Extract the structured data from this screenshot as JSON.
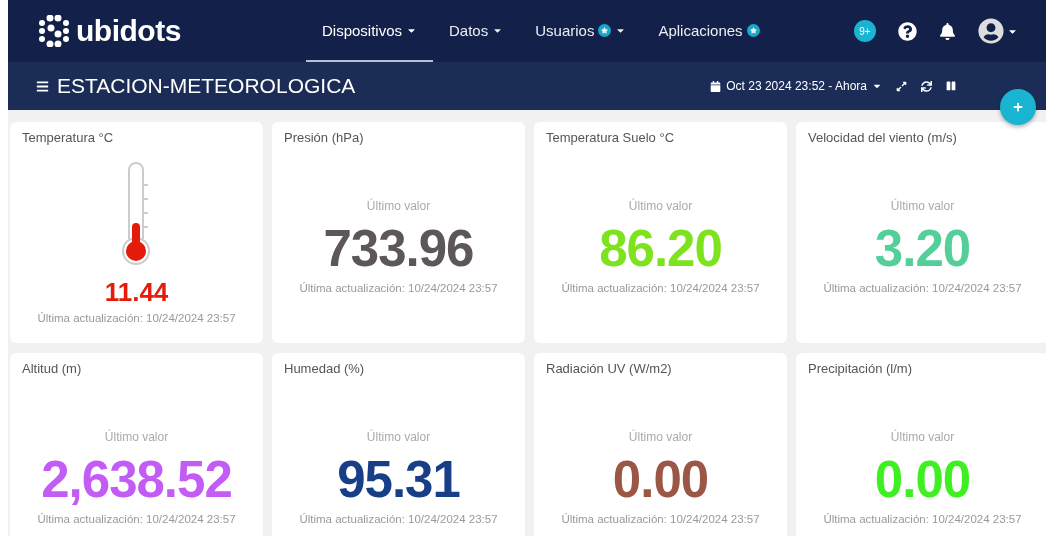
{
  "brand": {
    "name": "ubidots"
  },
  "nav": [
    {
      "label": "Dispositivos",
      "selected": true,
      "dropdown": true,
      "star": false
    },
    {
      "label": "Datos",
      "selected": false,
      "dropdown": true,
      "star": false
    },
    {
      "label": "Usuarios",
      "selected": false,
      "dropdown": true,
      "star": true
    },
    {
      "label": "Aplicaciones",
      "selected": false,
      "dropdown": false,
      "star": true
    }
  ],
  "notifications_badge": "9+",
  "dashboard": {
    "title": "ESTACION-METEOROLOGICA",
    "date_range": "Oct 23 2024 23:52 - Ahora"
  },
  "widgets": [
    {
      "kind": "thermometer",
      "title": "Temperatura °C",
      "value": "11.44",
      "color": "#e41c0c",
      "updated": "Última actualización: 10/24/2024 23:57"
    },
    {
      "kind": "metric",
      "title": "Presión (hPa)",
      "caption": "Último valor",
      "value": "733.96",
      "color": "#5e5759",
      "updated": "Última actualización: 10/24/2024 23:57"
    },
    {
      "kind": "metric",
      "title": "Temperatura Suelo °C",
      "caption": "Último valor",
      "value": "86.20",
      "color": "#7ee21f",
      "updated": "Última actualización: 10/24/2024 23:57"
    },
    {
      "kind": "metric",
      "title": "Velocidad del viento (m/s)",
      "caption": "Último valor",
      "value": "3.20",
      "color": "#55cf99",
      "updated": "Última actualización: 10/24/2024 23:57"
    },
    {
      "kind": "metric",
      "title": "Altitud (m)",
      "caption": "Último valor",
      "value": "2,638.52",
      "color": "#c35cf5",
      "updated": "Última actualización: 10/24/2024 23:57"
    },
    {
      "kind": "metric",
      "title": "Humedad (%)",
      "caption": "Último valor",
      "value": "95.31",
      "color": "#173e86",
      "updated": "Última actualización: 10/24/2024 23:57"
    },
    {
      "kind": "metric",
      "title": "Radiación UV (W/m2)",
      "caption": "Último valor",
      "value": "0.00",
      "color": "#9b5645",
      "updated": "Última actualización: 10/24/2024 23:57"
    },
    {
      "kind": "metric",
      "title": "Precipitación (l/m)",
      "caption": "Último valor",
      "value": "0.00",
      "color": "#3ef022",
      "updated": "Última actualización: 10/24/2024 23:57"
    }
  ]
}
